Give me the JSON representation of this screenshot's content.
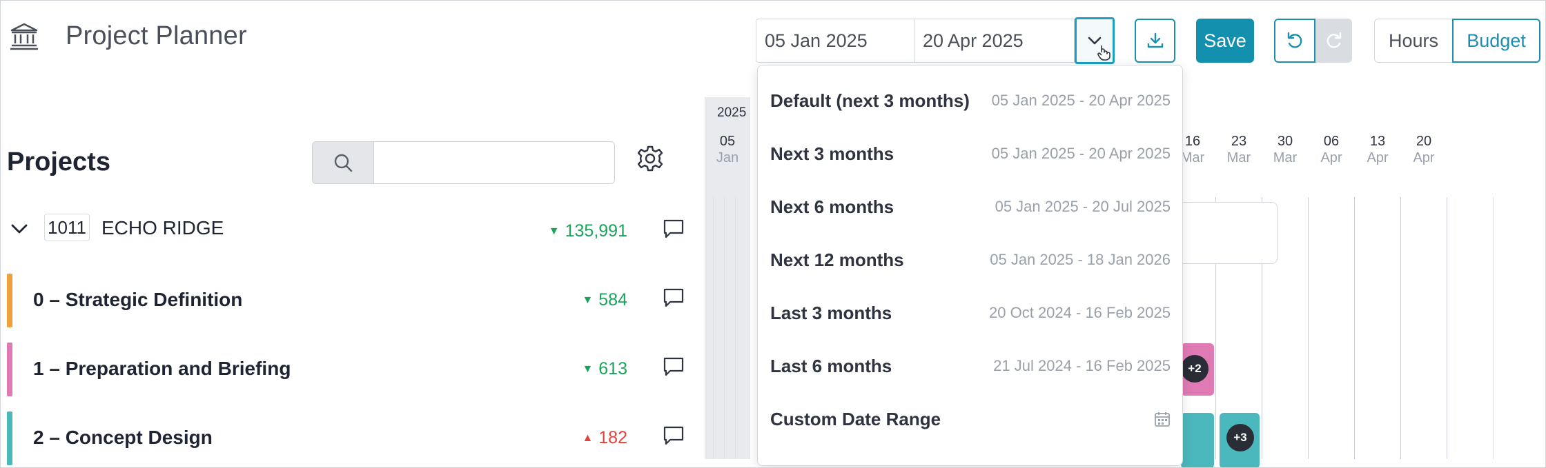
{
  "app": {
    "title": "Project Planner",
    "logo_icon": "bank-icon"
  },
  "toolbar": {
    "date_start": "05 Jan 2025",
    "date_end": "20 Apr 2025",
    "save_label": "Save",
    "view_toggle": {
      "hours": "Hours",
      "budget": "Budget",
      "selected": "Budget"
    },
    "accent_color": "#1390ad"
  },
  "date_dropdown": {
    "options": [
      {
        "label": "Default (next 3 months)",
        "range": "05 Jan 2025 - 20 Apr 2025"
      },
      {
        "label": "Next 3 months",
        "range": "05 Jan 2025 - 20 Apr 2025"
      },
      {
        "label": "Next 6 months",
        "range": "05 Jan 2025 - 20 Jul 2025"
      },
      {
        "label": "Next 12 months",
        "range": "05 Jan 2025 - 18 Jan 2026"
      },
      {
        "label": "Last 3 months",
        "range": "20 Oct 2024 - 16 Feb 2025"
      },
      {
        "label": "Last 6 months",
        "range": "21 Jul 2024 - 16 Feb 2025"
      },
      {
        "label": "Custom Date Range",
        "range": ""
      }
    ]
  },
  "projects": {
    "title": "Projects",
    "search_placeholder": "",
    "project": {
      "code": "1011",
      "name": "ECHO RIDGE",
      "value": "135,991",
      "trend": "down"
    },
    "phases": [
      {
        "label": "0 – Strategic Definition",
        "value": "584",
        "trend": "down",
        "color": "#f0a03a"
      },
      {
        "label": "1 – Preparation and Briefing",
        "value": "613",
        "trend": "down",
        "color": "#e07ab5"
      },
      {
        "label": "2 – Concept Design",
        "value": "182",
        "trend": "up",
        "color": "#4bb8bd"
      }
    ]
  },
  "timeline": {
    "year": "2025",
    "columns": [
      {
        "day": "05",
        "month": "Jan"
      },
      {
        "day": "16",
        "month": "Mar"
      },
      {
        "day": "23",
        "month": "Mar"
      },
      {
        "day": "30",
        "month": "Mar"
      },
      {
        "day": "06",
        "month": "Apr"
      },
      {
        "day": "13",
        "month": "Apr"
      },
      {
        "day": "20",
        "month": "Apr"
      }
    ],
    "badges": [
      "+2",
      "+3"
    ]
  }
}
